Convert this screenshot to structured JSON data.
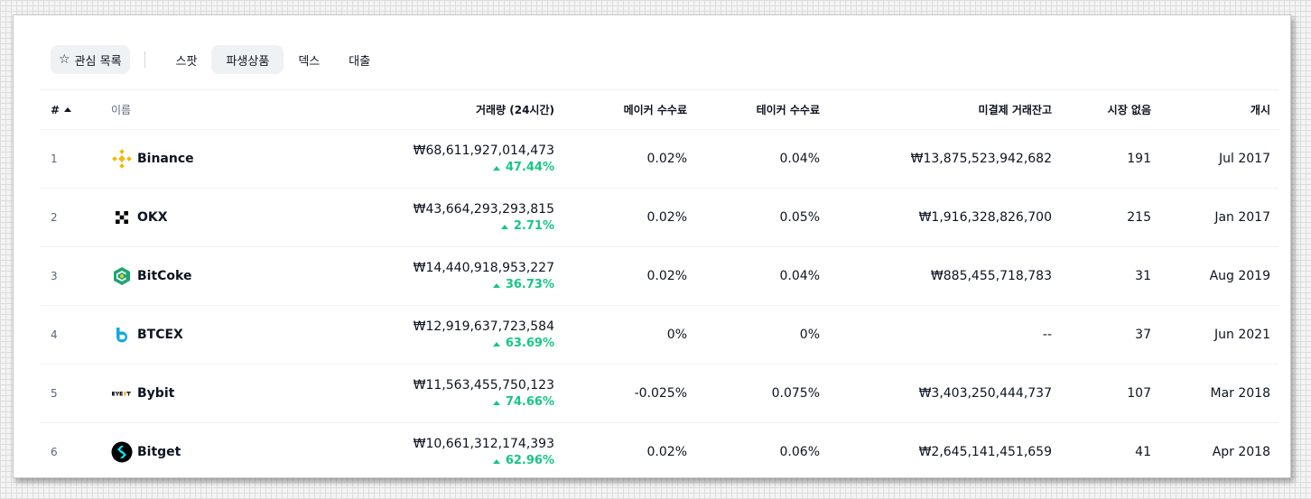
{
  "tabs": {
    "watchlist": "관심 목록",
    "items": [
      "스팟",
      "파생상품",
      "덱스",
      "대출"
    ],
    "active_index": 1
  },
  "table": {
    "headers": {
      "rank": "#",
      "name": "이름",
      "volume": "거래량 (24시간)",
      "maker_fee": "메이커 수수료",
      "taker_fee": "테이커 수수료",
      "open_interest": "미결제 거래잔고",
      "markets": "시장 없음",
      "launched": "개시"
    },
    "rows": [
      {
        "rank": "1",
        "name": "Binance",
        "logo": "binance-logo",
        "volume": "₩68,611,927,014,473",
        "change": "47.44%",
        "maker": "0.02%",
        "taker": "0.04%",
        "oi": "₩13,875,523,942,682",
        "markets": "191",
        "launched": "Jul 2017"
      },
      {
        "rank": "2",
        "name": "OKX",
        "logo": "okx-logo",
        "volume": "₩43,664,293,293,815",
        "change": "2.71%",
        "maker": "0.02%",
        "taker": "0.05%",
        "oi": "₩1,916,328,826,700",
        "markets": "215",
        "launched": "Jan 2017"
      },
      {
        "rank": "3",
        "name": "BitCoke",
        "logo": "bitcoke-logo",
        "volume": "₩14,440,918,953,227",
        "change": "36.73%",
        "maker": "0.02%",
        "taker": "0.04%",
        "oi": "₩885,455,718,783",
        "markets": "31",
        "launched": "Aug 2019"
      },
      {
        "rank": "4",
        "name": "BTCEX",
        "logo": "btcex-logo",
        "volume": "₩12,919,637,723,584",
        "change": "63.69%",
        "maker": "0%",
        "taker": "0%",
        "oi": "--",
        "markets": "37",
        "launched": "Jun 2021"
      },
      {
        "rank": "5",
        "name": "Bybit",
        "logo": "bybit-logo",
        "volume": "₩11,563,455,750,123",
        "change": "74.66%",
        "maker": "-0.025%",
        "taker": "0.075%",
        "oi": "₩3,403,250,444,737",
        "markets": "107",
        "launched": "Mar 2018"
      },
      {
        "rank": "6",
        "name": "Bitget",
        "logo": "bitget-logo",
        "volume": "₩10,661,312,174,393",
        "change": "62.96%",
        "maker": "0.02%",
        "taker": "0.06%",
        "oi": "₩2,645,141,451,659",
        "markets": "41",
        "launched": "Apr 2018"
      }
    ]
  },
  "colors": {
    "positive": "#16c784",
    "text": "#0d1421",
    "muted": "#58667e",
    "active_tab_bg": "#eff2f5"
  }
}
